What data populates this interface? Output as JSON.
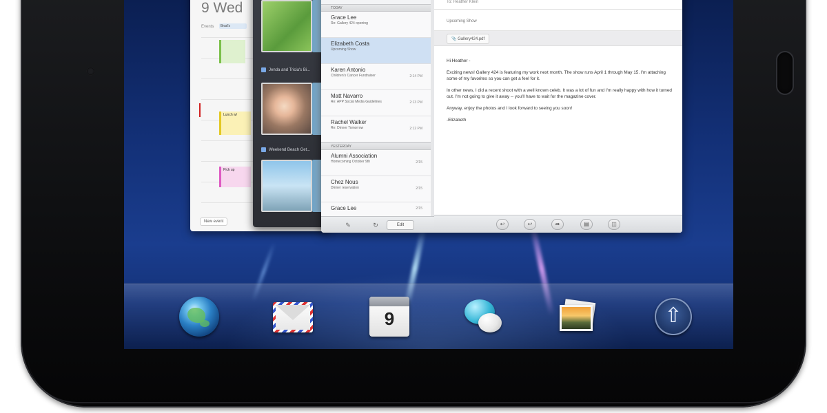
{
  "calendar": {
    "date_heading": "9 Wed",
    "events_label": "Events",
    "allday_event": "Brad's",
    "events": [
      {
        "color": "green",
        "title": ""
      },
      {
        "color": "yellow",
        "title": "Lunch w/"
      },
      {
        "color": "pink",
        "title": "Pick up"
      }
    ],
    "new_event_label": "New event",
    "dock_day": "9"
  },
  "photos": {
    "albums": [
      {
        "label": "Jenda and Tricia's Bi..."
      },
      {
        "label": "Weekend Beach Get..."
      }
    ]
  },
  "inbox": {
    "sections": [
      "TODAY",
      "YESTERDAY"
    ],
    "today": [
      {
        "from": "Grace Lee",
        "subject": "Re: Gallery 424 opening",
        "time": ""
      },
      {
        "from": "Elizabeth Costa",
        "subject": "Upcoming Show",
        "time": "",
        "selected": true
      },
      {
        "from": "Karen Antonio",
        "subject": "Children's Cancer Fundraiser",
        "time": "2:14 PM"
      },
      {
        "from": "Matt Navarro",
        "subject": "Re: APP Social Media Guidelines",
        "time": "2:13 PM"
      },
      {
        "from": "Rachel Walker",
        "subject": "Re: Dinner Tomorrow",
        "time": "2:12 PM"
      }
    ],
    "yesterday": [
      {
        "from": "Alumni Association",
        "subject": "Homecoming October 9th",
        "time": "2/15"
      },
      {
        "from": "Chez Nous",
        "subject": "Dinner reservation",
        "time": "2/15"
      },
      {
        "from": "Grace Lee",
        "subject": "",
        "time": "2/15"
      }
    ],
    "edit_label": "Edit"
  },
  "message": {
    "to": "Heather Klein",
    "subject": "Upcoming Show",
    "attachment": "Gallery424.pdf",
    "body": [
      "Hi Heather -",
      "Exciting news! Gallery 424 is featuring my work next month. The show runs April 1 through May 15. I'm attaching some of my favorites so you can get a feel for it.",
      "In other news, I did a recent shoot with a well known celeb. It was a lot of fun and I'm really happy with how it turned out. I'm not going to give it away -- you'll have to wait for the magazine cover.",
      "Anyway, enjoy the photos and I look forward to seeing you soon!",
      "-Elizabeth"
    ]
  },
  "dock": {
    "items": [
      "globe-icon",
      "mail-icon",
      "calendar-icon",
      "messaging-icon",
      "photos-icon",
      "launcher-icon"
    ]
  },
  "colors": {
    "screen_top": "#0b1f52",
    "screen_bottom": "#102a68",
    "bezel": "#0f1012",
    "selected_mail": "#cfe0f3"
  }
}
